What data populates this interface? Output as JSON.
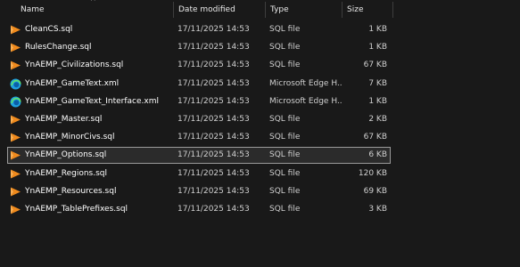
{
  "columns": {
    "name": "Name",
    "date_modified": "Date modified",
    "type": "Type",
    "size": "Size"
  },
  "sort": {
    "column": "name",
    "icon": "sort-ascending-icon"
  },
  "colors": {
    "background": "#191919",
    "selection_border": "#9a9a9a",
    "sql_icon": "#f08a1c",
    "edge_icon": "#1fa0e0"
  },
  "files": [
    {
      "name": "CleanCS.sql",
      "date": "17/11/2025 14:53",
      "type": "SQL file",
      "size": "1 KB",
      "icon": "sql-file-icon",
      "selected": false
    },
    {
      "name": "RulesChange.sql",
      "date": "17/11/2025 14:53",
      "type": "SQL file",
      "size": "1 KB",
      "icon": "sql-file-icon",
      "selected": false
    },
    {
      "name": "YnAEMP_Civilizations.sql",
      "date": "17/11/2025 14:53",
      "type": "SQL file",
      "size": "67 KB",
      "icon": "sql-file-icon",
      "selected": false
    },
    {
      "name": "YnAEMP_GameText.xml",
      "date": "17/11/2025 14:53",
      "type": "Microsoft Edge H...",
      "size": "7 KB",
      "icon": "edge-file-icon",
      "selected": false
    },
    {
      "name": "YnAEMP_GameText_Interface.xml",
      "date": "17/11/2025 14:53",
      "type": "Microsoft Edge H...",
      "size": "1 KB",
      "icon": "edge-file-icon",
      "selected": false
    },
    {
      "name": "YnAEMP_Master.sql",
      "date": "17/11/2025 14:53",
      "type": "SQL file",
      "size": "2 KB",
      "icon": "sql-file-icon",
      "selected": false
    },
    {
      "name": "YnAEMP_MinorCivs.sql",
      "date": "17/11/2025 14:53",
      "type": "SQL file",
      "size": "67 KB",
      "icon": "sql-file-icon",
      "selected": false
    },
    {
      "name": "YnAEMP_Options.sql",
      "date": "17/11/2025 14:53",
      "type": "SQL file",
      "size": "6 KB",
      "icon": "sql-file-icon",
      "selected": true
    },
    {
      "name": "YnAEMP_Regions.sql",
      "date": "17/11/2025 14:53",
      "type": "SQL file",
      "size": "120 KB",
      "icon": "sql-file-icon",
      "selected": false
    },
    {
      "name": "YnAEMP_Resources.sql",
      "date": "17/11/2025 14:53",
      "type": "SQL file",
      "size": "69 KB",
      "icon": "sql-file-icon",
      "selected": false
    },
    {
      "name": "YnAEMP_TablePrefixes.sql",
      "date": "17/11/2025 14:53",
      "type": "SQL file",
      "size": "3 KB",
      "icon": "sql-file-icon",
      "selected": false
    }
  ]
}
